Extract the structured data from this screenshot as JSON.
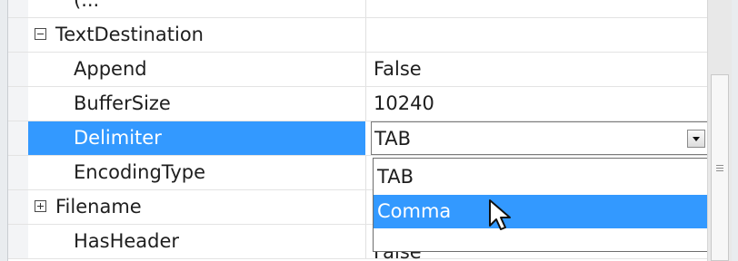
{
  "property_grid": {
    "cut_top_row": {
      "name": "(...",
      "value": ""
    },
    "rows": [
      {
        "name": "TextDestination",
        "value": "",
        "toggle": "minus"
      },
      {
        "name": "Append",
        "value": "False"
      },
      {
        "name": "BufferSize",
        "value": "10240"
      },
      {
        "name": "Delimiter",
        "value": "TAB",
        "selected": true
      },
      {
        "name": "EncodingType",
        "value": ""
      },
      {
        "name": "Filename",
        "value": "",
        "toggle": "plus"
      },
      {
        "name": "HasHeader",
        "value": "False"
      }
    ]
  },
  "dropdown": {
    "options": [
      "TAB",
      "Comma"
    ],
    "highlighted": "Comma"
  },
  "colors": {
    "selection": "#3399ff",
    "grid_background": "#ffffff",
    "gutter": "#f3f4f6"
  },
  "icons": {
    "collapse": "minus-box-icon",
    "expand": "plus-box-icon",
    "dropdown_arrow": "chevron-down-icon",
    "pointer": "mouse-pointer-icon"
  }
}
